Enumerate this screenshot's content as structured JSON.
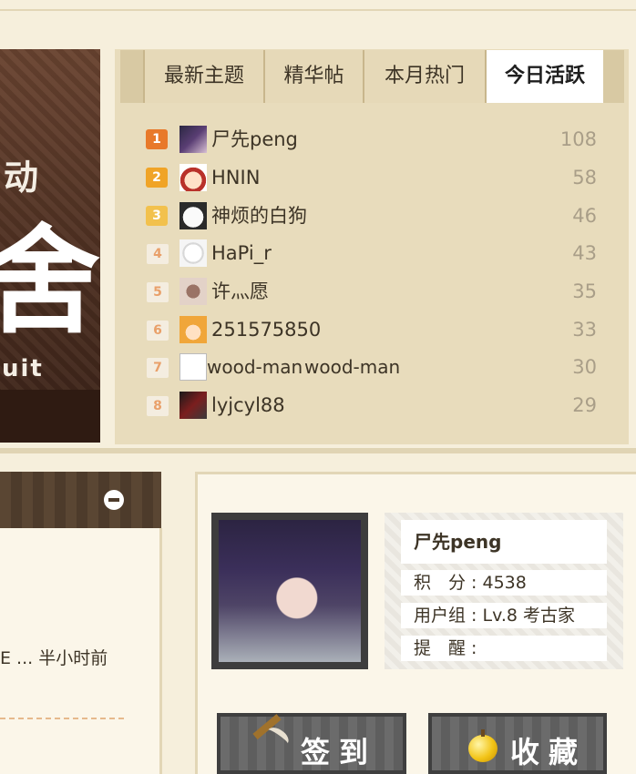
{
  "banner": {
    "line1": "动",
    "line2": "舍",
    "line3": "uit"
  },
  "tabs": [
    "最新主题",
    "精华帖",
    "本月热门",
    "今日活跃"
  ],
  "ranking": [
    {
      "rank": "1",
      "name": "尸先peng",
      "count": "108"
    },
    {
      "rank": "2",
      "name": "HNIN",
      "count": "58"
    },
    {
      "rank": "3",
      "name": "神烦的白狗",
      "count": "46"
    },
    {
      "rank": "4",
      "name": "HaPi_r",
      "count": "43"
    },
    {
      "rank": "5",
      "name": "许灬愿",
      "count": "35"
    },
    {
      "rank": "6",
      "name": "251575850",
      "count": "33"
    },
    {
      "rank": "7",
      "name": "wood-man",
      "alt": "wood-man",
      "count": "30"
    },
    {
      "rank": "8",
      "name": "lyjcyl88",
      "count": "29"
    }
  ],
  "left": {
    "text": "E ... 半小时前"
  },
  "user": {
    "name": "尸先peng",
    "points": "积　分 : 4538",
    "group": "用户组 : Lv.8 考古家",
    "remind": "提　醒 :"
  },
  "buttons": {
    "sign": "签到",
    "favorite": "收藏"
  },
  "colors": {
    "panel": "#e8dcbc",
    "active_tab": "#ffffff",
    "rank1": "#e8792a",
    "rank2": "#f0a427",
    "rank3": "#f2c14d"
  }
}
